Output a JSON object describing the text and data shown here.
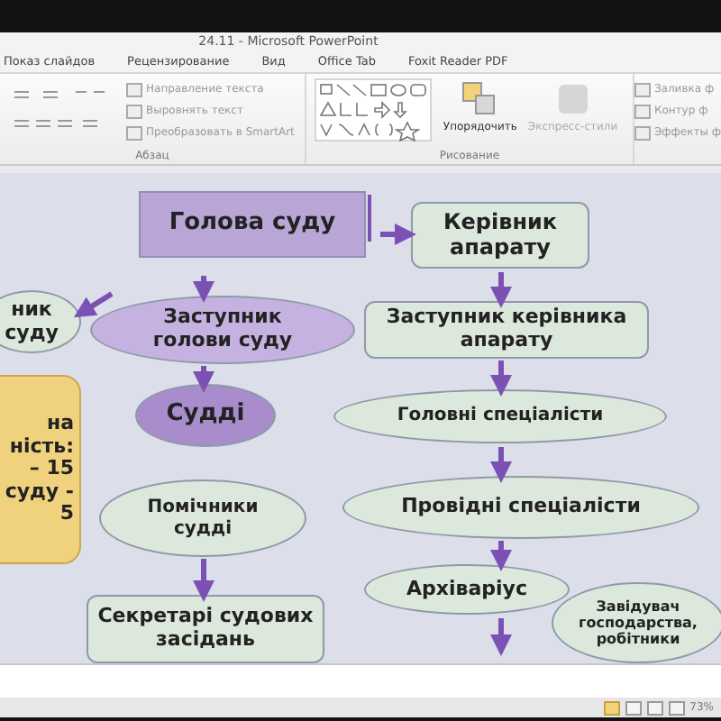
{
  "window": {
    "title": "24.11 - Microsoft PowerPoint"
  },
  "tabs": [
    {
      "label": "Показ слайдов",
      "selected": false
    },
    {
      "label": "Рецензирование",
      "selected": false
    },
    {
      "label": "Вид",
      "selected": false
    },
    {
      "label": "Office Tab",
      "selected": false
    },
    {
      "label": "Foxit Reader PDF",
      "selected": false
    }
  ],
  "ribbon": {
    "paragraph": {
      "label": "Абзац",
      "commands": [
        "Направление текста",
        "Выровнять текст",
        "Преобразовать в SmartArt"
      ]
    },
    "drawing": {
      "label": "Рисование",
      "commands": [
        "Упорядочить",
        "Экспресс-стили"
      ],
      "shape_commands": [
        "Заливка ф",
        "Контур ф",
        "Эффекты ф"
      ]
    }
  },
  "slide": {
    "nodes": [
      {
        "kind": "rect",
        "color": "#b9a5d6",
        "lines": [
          "Голова суду"
        ]
      },
      {
        "kind": "rounded",
        "color": "#dde8dc",
        "lines": [
          "Керівник",
          "апарату"
        ]
      },
      {
        "kind": "ellipse",
        "color": "#dde8dc",
        "lines": [
          "ник",
          "суду"
        ]
      },
      {
        "kind": "ellipse",
        "color": "#c6b2e0",
        "lines": [
          "Заступник",
          "голови суду"
        ]
      },
      {
        "kind": "rounded",
        "color": "#dde8dc",
        "lines": [
          "Заступник керівника",
          "апарату"
        ]
      },
      {
        "kind": "note",
        "color": "#f0d27e",
        "lines": [
          "на",
          "ність:",
          "– 15",
          "суду -",
          "5"
        ]
      },
      {
        "kind": "ellipse",
        "color": "#a88ccc",
        "lines": [
          "Судді"
        ]
      },
      {
        "kind": "ellipse",
        "color": "#dde8dc",
        "lines": [
          "Головні спеціалісти"
        ]
      },
      {
        "kind": "ellipse",
        "color": "#dde8dc",
        "lines": [
          "Помічники",
          "судді"
        ]
      },
      {
        "kind": "ellipse",
        "color": "#dde8dc",
        "lines": [
          "Провідні спеціалісти"
        ]
      },
      {
        "kind": "rounded",
        "color": "#dde8dc",
        "lines": [
          "Секретарі судових",
          "засідань"
        ]
      },
      {
        "kind": "ellipse",
        "color": "#dde8dc",
        "lines": [
          "Архіваріус"
        ]
      },
      {
        "kind": "ellipse",
        "color": "#dde8dc",
        "lines": [
          "Завідувач",
          "господарства,",
          "робітники"
        ]
      }
    ]
  },
  "status_bar": {
    "zoom": "73%"
  }
}
